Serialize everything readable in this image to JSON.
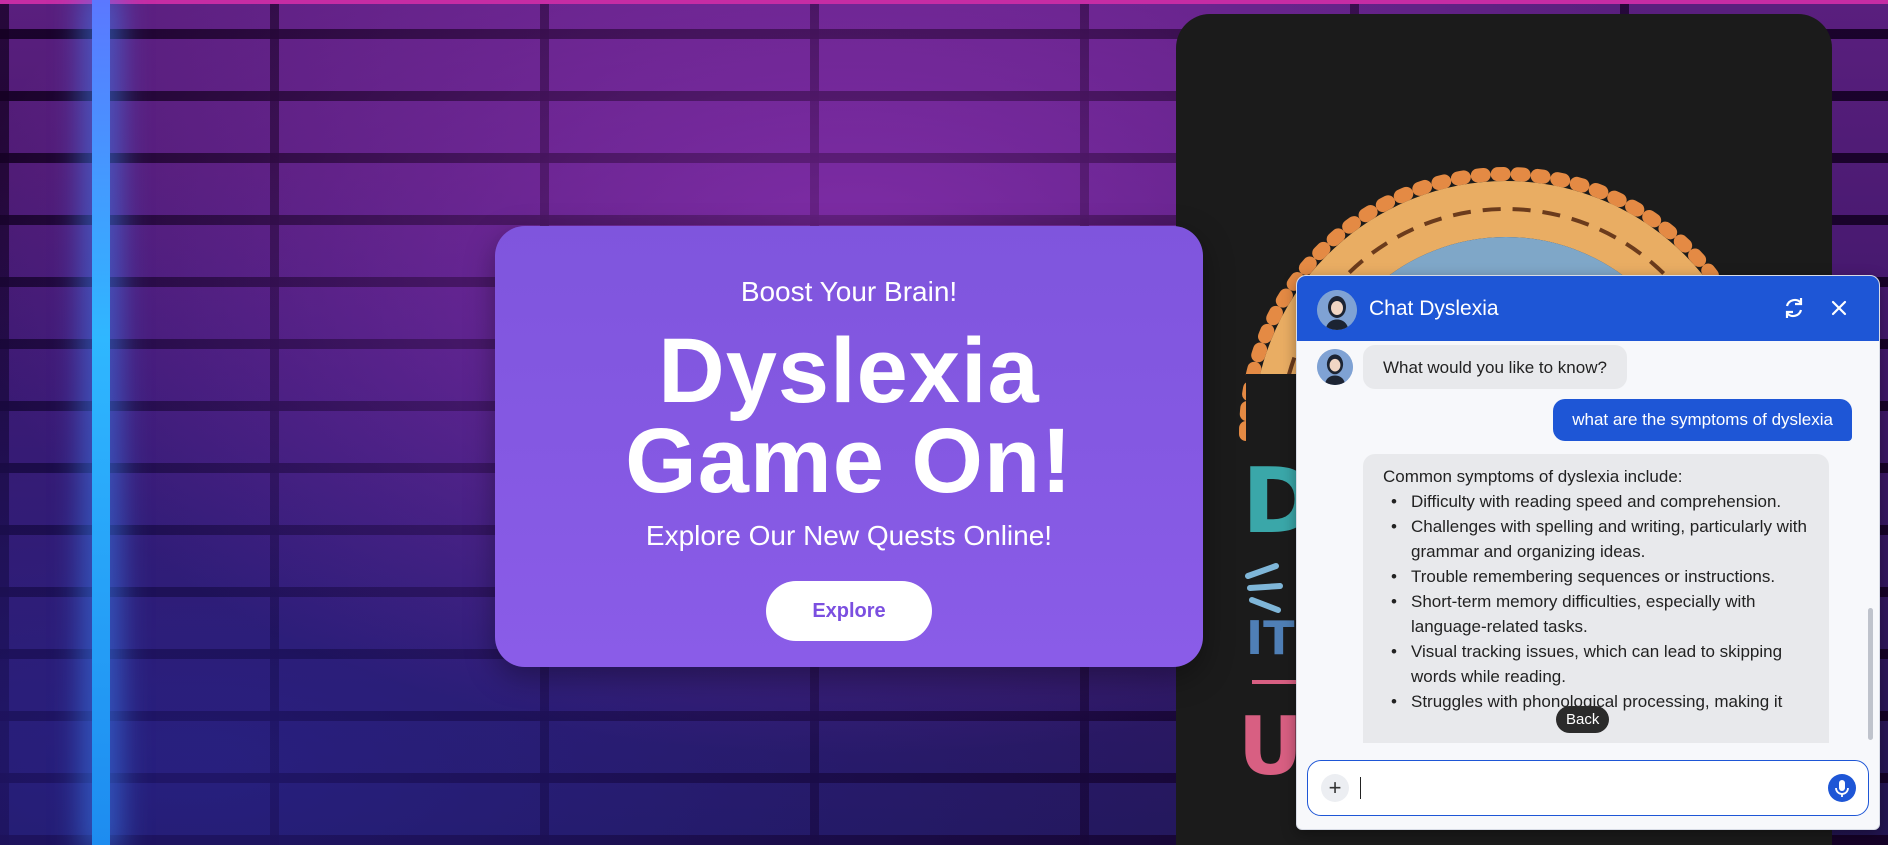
{
  "hero": {
    "kicker": "Boost Your Brain!",
    "title_line1": "Dyslexia",
    "title_line2": "Game On!",
    "subtitle": "Explore Our New Quests Online!",
    "button_label": "Explore"
  },
  "chat": {
    "title": "Chat Dyslexia",
    "greeting": "What would you like to know?",
    "user_message": "what are the symptoms of dyslexia",
    "answer_intro": "Common symptoms of dyslexia include:",
    "answer_items": [
      "Difficulty with reading speed and comprehension.",
      "Challenges with spelling and writing, particularly with grammar and organizing ideas.",
      "Trouble remembering sequences or instructions.",
      "Short-term memory difficulties, especially with language-related tasks.",
      "Visual tracking issues, which can lead to skipping words while reading.",
      "Struggles with phonological processing, making it"
    ],
    "tooltip": "Back",
    "input_value": "",
    "icons": {
      "refresh": "refresh-icon",
      "close": "close-icon",
      "add": "plus-icon",
      "mic": "microphone-icon"
    }
  },
  "colors": {
    "hero_bg": "#8a5ce8",
    "chat_header": "#1e56d6",
    "user_bubble": "#1e56d6",
    "bot_bubble": "#e8e9ec"
  }
}
